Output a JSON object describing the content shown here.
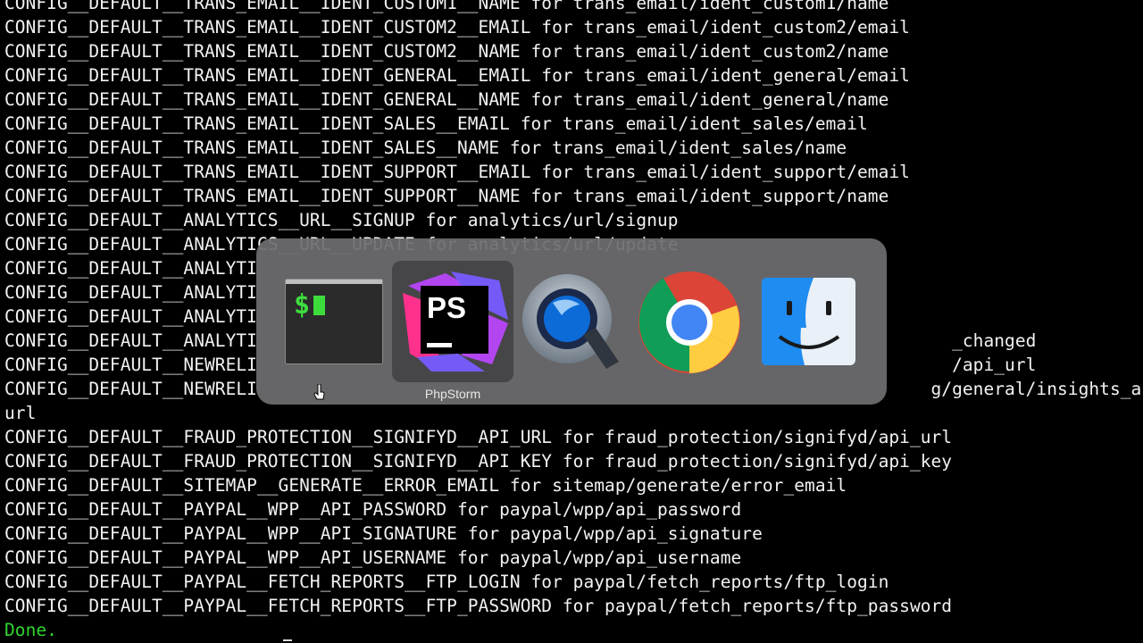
{
  "terminal": {
    "lines": [
      "CONFIG__DEFAULT__TRANS_EMAIL__IDENT_CUSTOM1__NAME for trans_email/ident_custom1/name",
      "CONFIG__DEFAULT__TRANS_EMAIL__IDENT_CUSTOM2__EMAIL for trans_email/ident_custom2/email",
      "CONFIG__DEFAULT__TRANS_EMAIL__IDENT_CUSTOM2__NAME for trans_email/ident_custom2/name",
      "CONFIG__DEFAULT__TRANS_EMAIL__IDENT_GENERAL__EMAIL for trans_email/ident_general/email",
      "CONFIG__DEFAULT__TRANS_EMAIL__IDENT_GENERAL__NAME for trans_email/ident_general/name",
      "CONFIG__DEFAULT__TRANS_EMAIL__IDENT_SALES__EMAIL for trans_email/ident_sales/email",
      "CONFIG__DEFAULT__TRANS_EMAIL__IDENT_SALES__NAME for trans_email/ident_sales/name",
      "CONFIG__DEFAULT__TRANS_EMAIL__IDENT_SUPPORT__EMAIL for trans_email/ident_support/email",
      "CONFIG__DEFAULT__TRANS_EMAIL__IDENT_SUPPORT__NAME for trans_email/ident_support/name",
      "CONFIG__DEFAULT__ANALYTICS__URL__SIGNUP for analytics/url/signup",
      "CONFIG__DEFAULT__ANALYTICS__URL__UPDATE for analytics/url/update",
      "CONFIG__DEFAULT__ANALYTI",
      "CONFIG__DEFAULT__ANALYTI",
      "CONFIG__DEFAULT__ANALYTI",
      "CONFIG__DEFAULT__ANALYTI                                                                  _changed",
      "CONFIG__DEFAULT__NEWRELI                                                                  /api_url",
      "CONFIG__DEFAULT__NEWRELI                                                                g/general/insights_api_",
      "url",
      "CONFIG__DEFAULT__FRAUD_PROTECTION__SIGNIFYD__API_URL for fraud_protection/signifyd/api_url",
      "CONFIG__DEFAULT__FRAUD_PROTECTION__SIGNIFYD__API_KEY for fraud_protection/signifyd/api_key",
      "CONFIG__DEFAULT__SITEMAP__GENERATE__ERROR_EMAIL for sitemap/generate/error_email",
      "CONFIG__DEFAULT__PAYPAL__WPP__API_PASSWORD for paypal/wpp/api_password",
      "CONFIG__DEFAULT__PAYPAL__WPP__API_SIGNATURE for paypal/wpp/api_signature",
      "CONFIG__DEFAULT__PAYPAL__WPP__API_USERNAME for paypal/wpp/api_username",
      "CONFIG__DEFAULT__PAYPAL__FETCH_REPORTS__FTP_LOGIN for paypal/fetch_reports/ftp_login",
      "CONFIG__DEFAULT__PAYPAL__FETCH_REPORTS__FTP_PASSWORD for paypal/fetch_reports/ftp_password"
    ],
    "done_text": "Done.",
    "done_color": "#2fd62f",
    "text_color": "#f2f2f2"
  },
  "switcher": {
    "apps": [
      {
        "name": "Terminal",
        "icon": "terminal-icon",
        "selected": false
      },
      {
        "name": "PhpStorm",
        "icon": "phpstorm-icon",
        "selected": true
      },
      {
        "name": "QuickTime Player",
        "icon": "quicktime-icon",
        "selected": false
      },
      {
        "name": "Google Chrome",
        "icon": "chrome-icon",
        "selected": false
      },
      {
        "name": "Finder",
        "icon": "finder-icon",
        "selected": false
      }
    ],
    "selected_label": "PhpStorm",
    "phpstorm_icon_text": "PS",
    "terminal_icon_text": "$"
  }
}
